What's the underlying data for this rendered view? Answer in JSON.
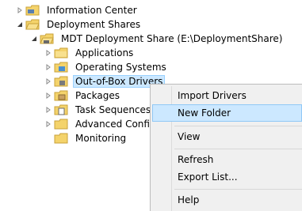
{
  "tree": {
    "items": [
      {
        "label": "Information Center",
        "expander": "collapsed",
        "icon": "folder-icon"
      },
      {
        "label": "Deployment Shares",
        "expander": "expanded",
        "icon": "folder-icon"
      },
      {
        "label": "MDT Deployment Share (E:\\DeploymentShare)",
        "expander": "expanded",
        "icon": "deployment-share-icon"
      },
      {
        "label": "Applications",
        "expander": "collapsed",
        "icon": "folder-icon"
      },
      {
        "label": "Operating Systems",
        "expander": "collapsed",
        "icon": "folder-icon"
      },
      {
        "label": "Out-of-Box Drivers",
        "expander": "collapsed",
        "icon": "folder-icon",
        "selected": true
      },
      {
        "label": "Packages",
        "expander": "collapsed",
        "icon": "folder-icon"
      },
      {
        "label": "Task Sequences",
        "expander": "collapsed",
        "icon": "folder-icon"
      },
      {
        "label": "Advanced Configu",
        "expander": "collapsed",
        "icon": "folder-icon"
      },
      {
        "label": "Monitoring",
        "expander": "none",
        "icon": "folder-icon"
      }
    ]
  },
  "context_menu": {
    "items": [
      {
        "label": "Import Drivers"
      },
      {
        "label": "New Folder",
        "highlighted": true
      },
      {
        "label": "View"
      },
      {
        "label": "Refresh"
      },
      {
        "label": "Export List..."
      },
      {
        "label": "Help"
      }
    ]
  },
  "colors": {
    "selection_bg": "#cce8ff",
    "selection_border": "#99d1ff",
    "folder_yellow": "#f4d36b",
    "menu_bg": "#f0f0f0"
  }
}
